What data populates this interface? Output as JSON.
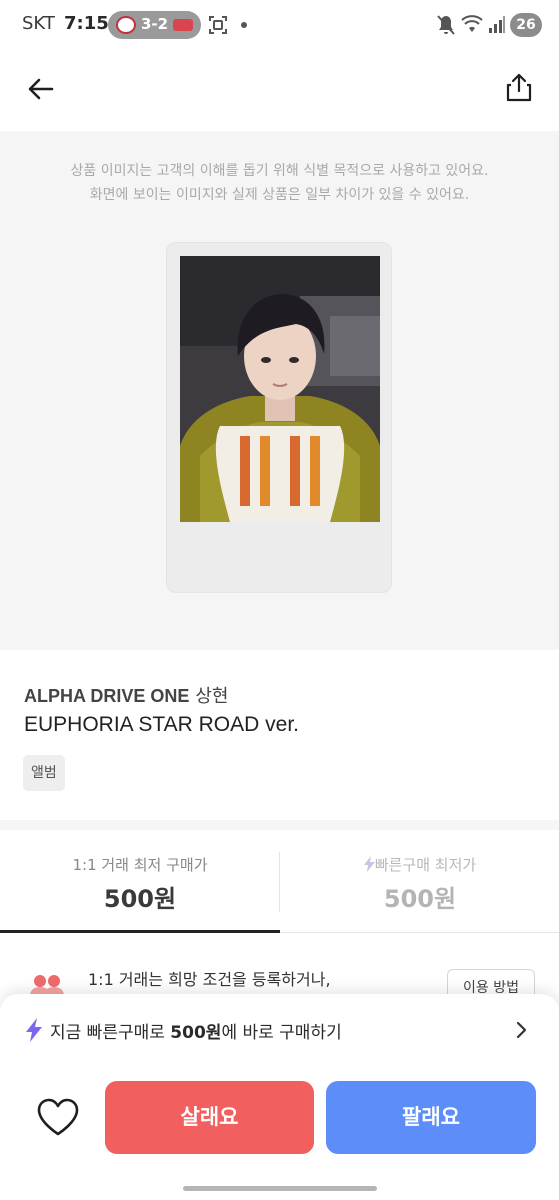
{
  "status_bar": {
    "carrier": "SKT",
    "time": "7:15",
    "score": "3-2",
    "battery": "26"
  },
  "notice": {
    "line1": "상품 이미지는 고객의 이해를 돕기 위해 식별 목적으로 사용하고 있어요.",
    "line2": "화면에 보이는 이미지와 실제 상품은 일부 차이가 있을 수 있어요."
  },
  "product": {
    "artist": "ALPHA DRIVE ONE",
    "member": "상현",
    "name": "EUPHORIA STAR ROAD ver.",
    "category": "앨범"
  },
  "price_tabs": [
    {
      "label": "1:1 거래 최저 구매가",
      "value": "500원",
      "selected": true
    },
    {
      "label": "빠른구매 최저가",
      "value": "500원",
      "selected": false
    }
  ],
  "guide": {
    "text": "1:1 거래는 희망 조건을 등록하거나,",
    "button": "이용 방법"
  },
  "quick_buy": {
    "prefix": "지금 빠른구매로 ",
    "price": "500원",
    "suffix": "에 바로 구매하기"
  },
  "actions": {
    "buy": "살래요",
    "sell": "팔래요"
  },
  "colors": {
    "buy": "#f25f5f",
    "sell": "#5d8df9",
    "bolt": "#7b68ee",
    "selected_tab": "#222222"
  },
  "icons": {
    "back": "arrow-left-icon",
    "share": "share-icon",
    "wishlist": "heart-outline-icon",
    "quick": "lightning-bolt-icon",
    "guide": "people-icon"
  }
}
